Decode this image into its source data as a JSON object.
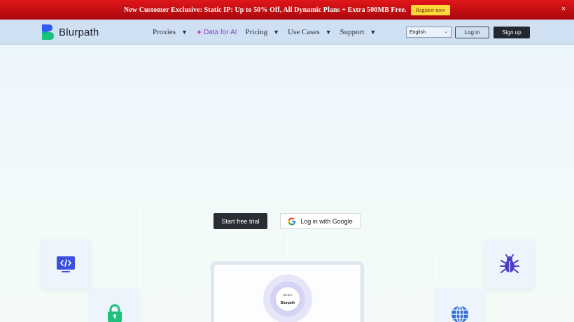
{
  "promo": {
    "text": "New Customer Exclusive: Static IP: Up to 50% Off, All Dynamic Plans + Extra 500MB Free.",
    "button": "Register now",
    "close": "×"
  },
  "nav": {
    "brand": "Blurpath",
    "items": [
      {
        "label": "Proxies",
        "has_caret": true
      },
      {
        "label": "Data for AI",
        "has_caret": false
      },
      {
        "label": "Pricing",
        "has_caret": true
      },
      {
        "label": "Use Cases",
        "has_caret": true
      },
      {
        "label": "Support",
        "has_caret": true
      }
    ],
    "language": "English",
    "login": "Log in",
    "signup": "Sign up"
  },
  "hero": {
    "trial_button": "Start free trial",
    "google_button": "Log in with Google"
  },
  "device": {
    "percent": "99.9%",
    "brand": "Blurpath"
  },
  "icons": {
    "code": "code-window-icon",
    "lock": "padlock-icon",
    "bug": "bug-icon",
    "globe": "globe-icon"
  },
  "colors": {
    "promo_red": "#d8111a",
    "promo_button": "#ffd93a",
    "nav_bg": "#cfe0f3",
    "dark_button": "#23272f",
    "brand_blue": "#2f5df0",
    "brand_green": "#18c27a",
    "code_icon_bg": "#3b4fe0",
    "lock_green": "#1fc07a",
    "bug_purple": "#4b3fc8",
    "globe_blue": "#2f6fd8"
  }
}
